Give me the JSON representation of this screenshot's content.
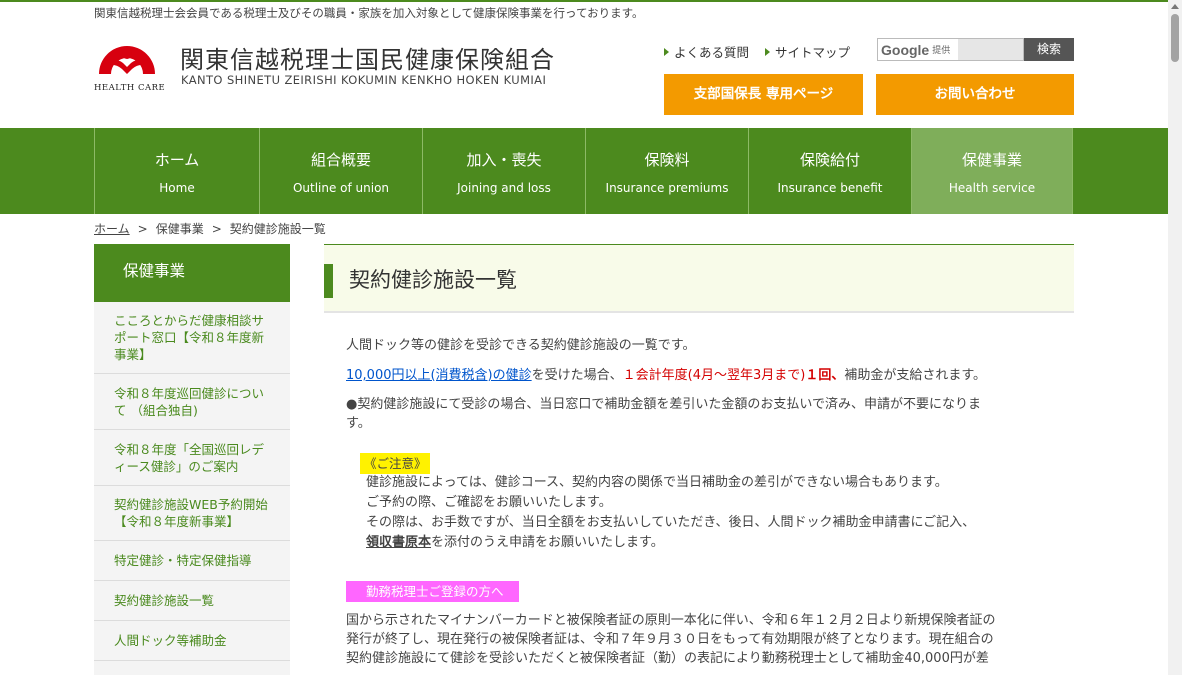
{
  "header": {
    "tagline": "関東信越税理士会会員である税理士及びその職員・家族を加入対象として健康保険事業を行っております。",
    "logo_caption": "HEALTH CARE",
    "site_title": "関東信越税理士国民健康保険組合",
    "site_subtitle": "KANTO SHINETU ZEIRISHI KOKUMIN KENKHO HOKEN KUMIAI",
    "links": {
      "faq": "よくある質問",
      "sitemap": "サイトマップ"
    },
    "search": {
      "brand": "Google",
      "provided": "提供",
      "button": "検索"
    },
    "buttons": {
      "branch": "支部国保長 専用ページ",
      "contact": "お問い合わせ"
    }
  },
  "nav": {
    "items": [
      {
        "jp": "ホーム",
        "en": "Home"
      },
      {
        "jp": "組合概要",
        "en": "Outline of union"
      },
      {
        "jp": "加入・喪失",
        "en": "Joining and loss"
      },
      {
        "jp": "保険料",
        "en": "Insurance premiums"
      },
      {
        "jp": "保険給付",
        "en": "Insurance benefit"
      },
      {
        "jp": "保健事業",
        "en": "Health service"
      }
    ]
  },
  "breadcrumb": {
    "home": "ホーム",
    "sep": ">",
    "section": "保健事業",
    "current": "契約健診施設一覧"
  },
  "sidebar": {
    "heading": "保健事業",
    "items": [
      {
        "l1": "こころとからだ健康相談サ",
        "l2": "ポート窓口【令和８年度新",
        "l3": "事業】"
      },
      {
        "l1": "令和８年度巡回健診につい",
        "l2": "て （組合独自)"
      },
      {
        "l1": "令和８年度「全国巡回レデ",
        "l2": "ィース健診」のご案内"
      },
      {
        "l1": "契約健診施設WEB予約開始",
        "l2": "【令和８年度新事業】"
      },
      {
        "l1": "特定健診・特定保健指導"
      },
      {
        "l1": "契約健診施設一覧"
      },
      {
        "l1": "人間ドック等補助金"
      }
    ]
  },
  "main": {
    "title": "契約健診施設一覧",
    "intro": "人間ドック等の健診を受診できる契約健診施設の一覧です。",
    "subsidy": {
      "link": "10,000円以上(消費税含)の健診",
      "t1": "を受けた場合、",
      "red": "１会計年度(4月～翌年3月まで)",
      "redbold": "１回、",
      "t2": "補助金が支給されます。"
    },
    "bullet_l1": "●契約健診施設にて受診の場合、当日窓口で補助金額を差引いた金額のお支払いで済み、申請が不要になりま",
    "bullet_l2": "す。",
    "notice": {
      "label": "《ご注意》",
      "l1": "健診施設によっては、健診コース、契約内容の関係で当日補助金の差引ができない場合もあります。",
      "l2": "ご予約の際、ご確認をお願いいたします。",
      "l3": "その際は、お手数ですが、当日全額をお支払いしていただき、後日、人間ドック補助金申請書にご記入、",
      "l4_bold": "領収書原本",
      "l4": "を添付のうえ申請をお願いいたします。"
    },
    "tax_notice": {
      "label": "勤務税理士ご登録の方へ",
      "l1": "国から示されたマイナンバーカードと被保険者証の原則一本化に伴い、令和６年１２月２日より新規保険者証の",
      "l2": "発行が終了し、現在発行の被保険者証は、令和７年９月３０日をもって有効期限が終了となります。現在組合の",
      "l3": "契約健診施設にて健診を受診いただくと被保険者証（勤）の表記により勤務税理士として補助金40,000円が差"
    }
  },
  "colors": {
    "brand_green": "#4c8a1e",
    "active_green": "#7fae5a",
    "orange": "#f39a00",
    "logo_red": "#d7000f",
    "notice_yellow": "#fff200",
    "notice_pink": "#ff66ff"
  }
}
